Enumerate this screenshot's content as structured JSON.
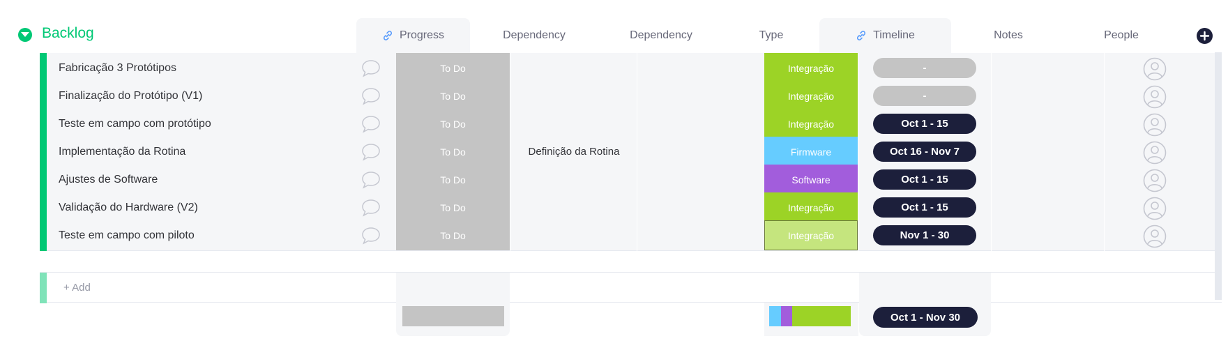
{
  "group": {
    "title": "Backlog",
    "color": "#00c875",
    "toggle_icon": "chevron-down-icon"
  },
  "columns": {
    "progress": "Progress",
    "dependency1": "Dependency",
    "dependency2": "Dependency",
    "type": "Type",
    "timeline": "Timeline",
    "notes": "Notes",
    "people": "People"
  },
  "colors": {
    "integracao": "#9cd326",
    "firmware": "#66ccff",
    "software": "#a25ddc",
    "integracao_faded": "#c5e57e",
    "timeline_active": "#1c1f3b",
    "timeline_empty": "#c4c4c4",
    "status_todo": "#c4c4c4"
  },
  "rows": [
    {
      "name": "Fabricação 3 Protótipos",
      "progress": "To Do",
      "dependency": "",
      "type": "Integração",
      "timeline": "-"
    },
    {
      "name": "Finalização do Protótipo (V1)",
      "progress": "To Do",
      "dependency": "",
      "type": "Integração",
      "timeline": "-"
    },
    {
      "name": "Teste em campo com protótipo",
      "progress": "To Do",
      "dependency": "",
      "type": "Integração",
      "timeline": "Oct 1 - 15"
    },
    {
      "name": "Implementação da Rotina",
      "progress": "To Do",
      "dependency": "Definição da Rotina",
      "type": "Firmware",
      "timeline": "Oct 16 - Nov 7"
    },
    {
      "name": "Ajustes de Software",
      "progress": "To Do",
      "dependency": "",
      "type": "Software",
      "timeline": "Oct 1 - 15"
    },
    {
      "name": "Validação do Hardware (V2)",
      "progress": "To Do",
      "dependency": "",
      "type": "Integração",
      "timeline": "Oct 1 - 15"
    },
    {
      "name": "Teste em campo com piloto",
      "progress": "To Do",
      "dependency": "",
      "type": "Integração",
      "timeline": "Nov 1 - 30"
    }
  ],
  "add_row": {
    "label": "+ Add"
  },
  "summary": {
    "timeline": "Oct 1 - Nov 30",
    "type_distribution": [
      {
        "type": "Firmware",
        "count": 1
      },
      {
        "type": "Software",
        "count": 1
      },
      {
        "type": "Integração",
        "count": 5
      }
    ]
  },
  "icons": {
    "comment": "comment-bubble-icon",
    "person": "person-avatar-icon",
    "link": "link-icon",
    "add_column": "plus-circle-icon"
  }
}
